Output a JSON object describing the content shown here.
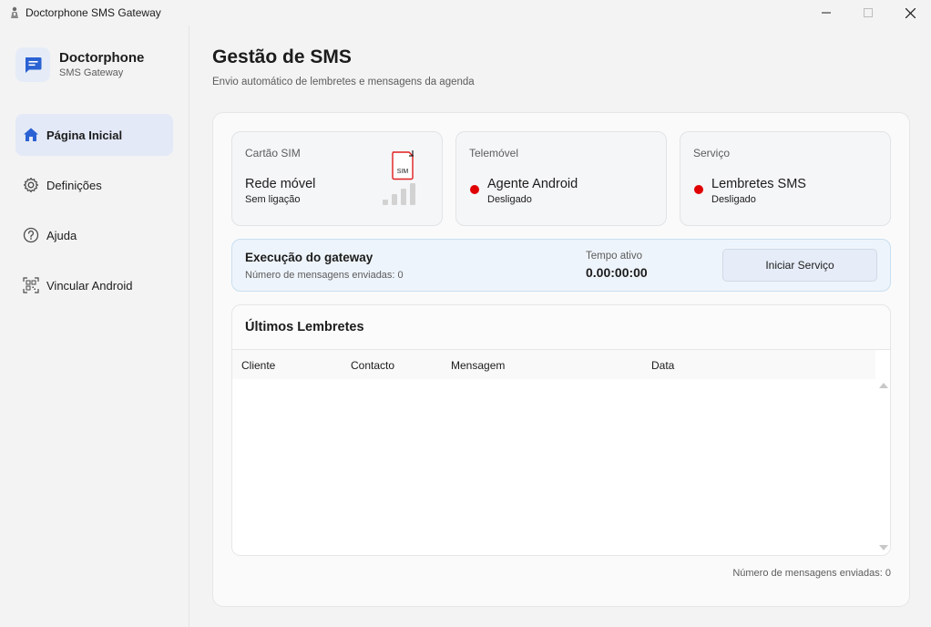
{
  "window": {
    "title": "Doctorphone SMS Gateway"
  },
  "sidebar": {
    "brand_name": "Doctorphone",
    "brand_sub": "SMS Gateway",
    "items": [
      {
        "label": "Página Inicial",
        "icon": "home-icon",
        "active": true
      },
      {
        "label": "Definições",
        "icon": "gear-icon",
        "active": false
      },
      {
        "label": "Ajuda",
        "icon": "help-icon",
        "active": false
      },
      {
        "label": "Vincular Android",
        "icon": "qr-code-icon",
        "active": false
      }
    ]
  },
  "header": {
    "title": "Gestão de SMS",
    "subtitle": "Envio automático de lembretes e mensagens da agenda"
  },
  "cards": {
    "sim": {
      "title": "Cartão SIM",
      "main": "Rede móvel",
      "status": "Sem ligação",
      "sim_label": "SIM"
    },
    "phone": {
      "title": "Telemóvel",
      "main": "Agente Android",
      "status": "Desligado"
    },
    "service": {
      "title": "Serviço",
      "main": "Lembretes SMS",
      "status": "Desligado"
    }
  },
  "gateway": {
    "title": "Execução do gateway",
    "sent_count": "Número de mensagens enviadas: 0",
    "uptime_label": "Tempo ativo",
    "uptime_value": "0.00:00:00",
    "start_button": "Iniciar Serviço"
  },
  "reminders": {
    "title": "Últimos Lembretes",
    "columns": [
      "Cliente",
      "Contacto",
      "Mensagem",
      "Data"
    ],
    "rows": []
  },
  "footer": {
    "sent_count": "Número de mensagens enviadas: 0"
  },
  "colors": {
    "accent": "#2b62d3",
    "status_off": "#e00000",
    "active_nav_bg": "#e3e9f7"
  }
}
